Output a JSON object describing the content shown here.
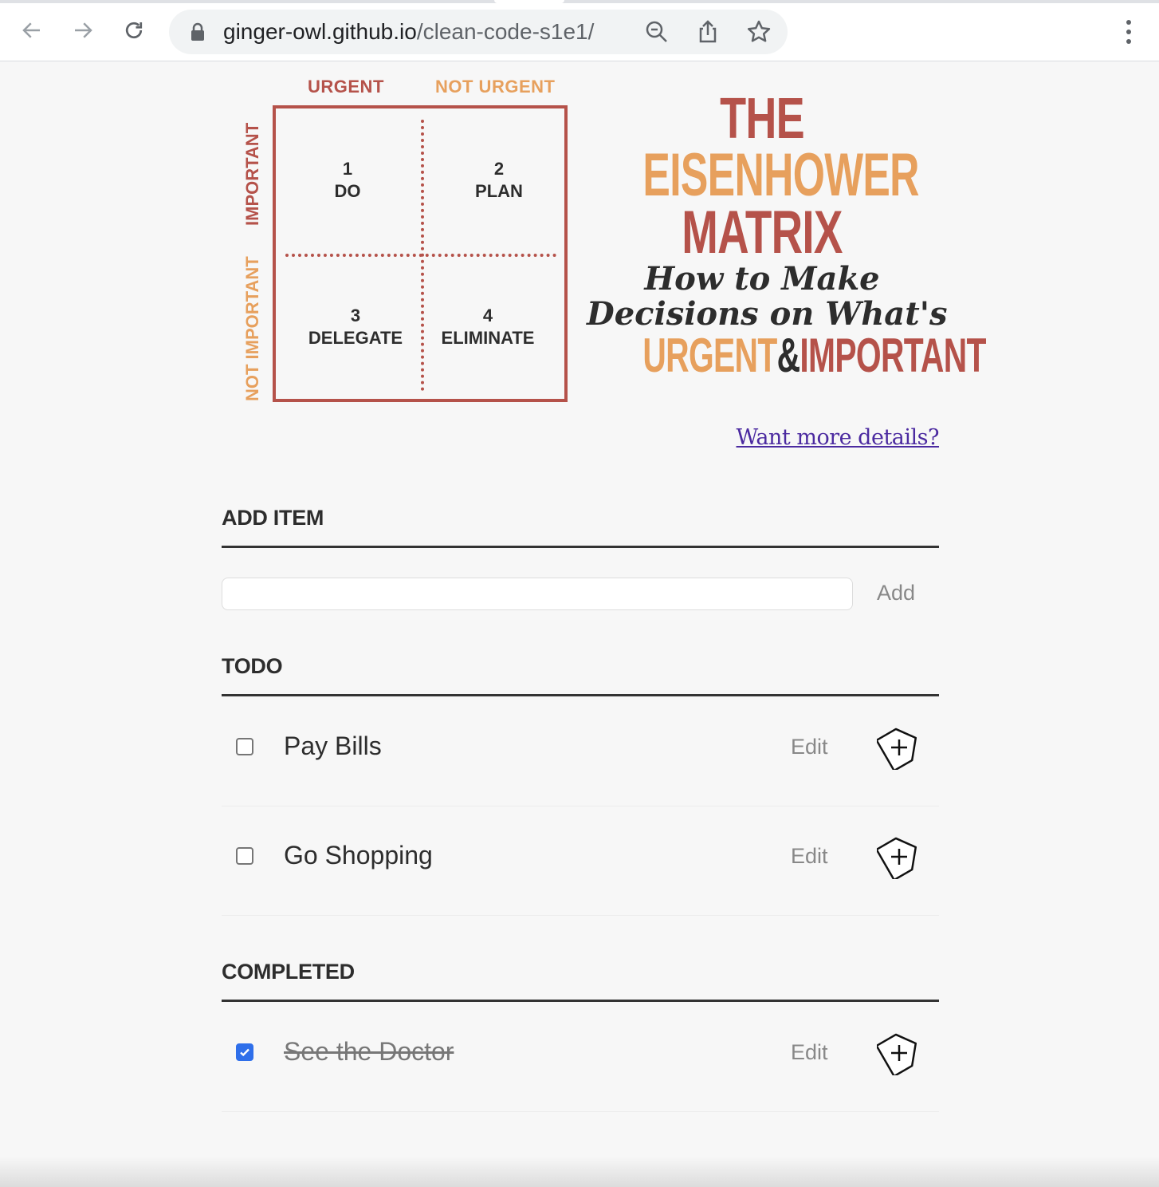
{
  "browser": {
    "url_host": "ginger-owl.github.io",
    "url_path": "/clean-code-s1e1/"
  },
  "graphic": {
    "col_urgent": "URGENT",
    "col_not_urgent": "NOT URGENT",
    "row_important": "IMPORTANT",
    "row_not_important": "NOT IMPORTANT",
    "quadrants": [
      {
        "number": "1",
        "label": "DO"
      },
      {
        "number": "2",
        "label": "PLAN"
      },
      {
        "number": "3",
        "label": "DELEGATE"
      },
      {
        "number": "4",
        "label": "ELIMINATE"
      }
    ],
    "title_the": "THE",
    "title_eisenhower": "EISENHOWER",
    "title_matrix": "MATRIX",
    "subtitle_line1": "How to Make",
    "subtitle_line2": "Decisions on What's",
    "subtitle_urgent": "URGENT",
    "subtitle_amp": "&",
    "subtitle_important": "IMPORTANT",
    "colors": {
      "red": "#b5524a",
      "orange": "#e7a05d",
      "dark": "#2d2d2d"
    }
  },
  "details_link": "Want more details?",
  "add_section": {
    "title": "ADD ITEM",
    "input_value": "",
    "button_label": "Add"
  },
  "todo_section": {
    "title": "TODO",
    "items": [
      {
        "label": "Pay Bills",
        "checked": false,
        "edit_label": "Edit"
      },
      {
        "label": "Go Shopping",
        "checked": false,
        "edit_label": "Edit"
      }
    ]
  },
  "completed_section": {
    "title": "COMPLETED",
    "items": [
      {
        "label": "See the Doctor",
        "checked": true,
        "edit_label": "Edit"
      }
    ]
  },
  "icons": {
    "back": "arrow-left-icon",
    "forward": "arrow-right-icon",
    "reload": "reload-icon",
    "lock": "lock-icon",
    "zoom": "zoom-out-icon",
    "share": "share-icon",
    "bookmark": "star-icon",
    "menu": "kebab-menu-icon",
    "item_action": "tag-plus-icon"
  }
}
